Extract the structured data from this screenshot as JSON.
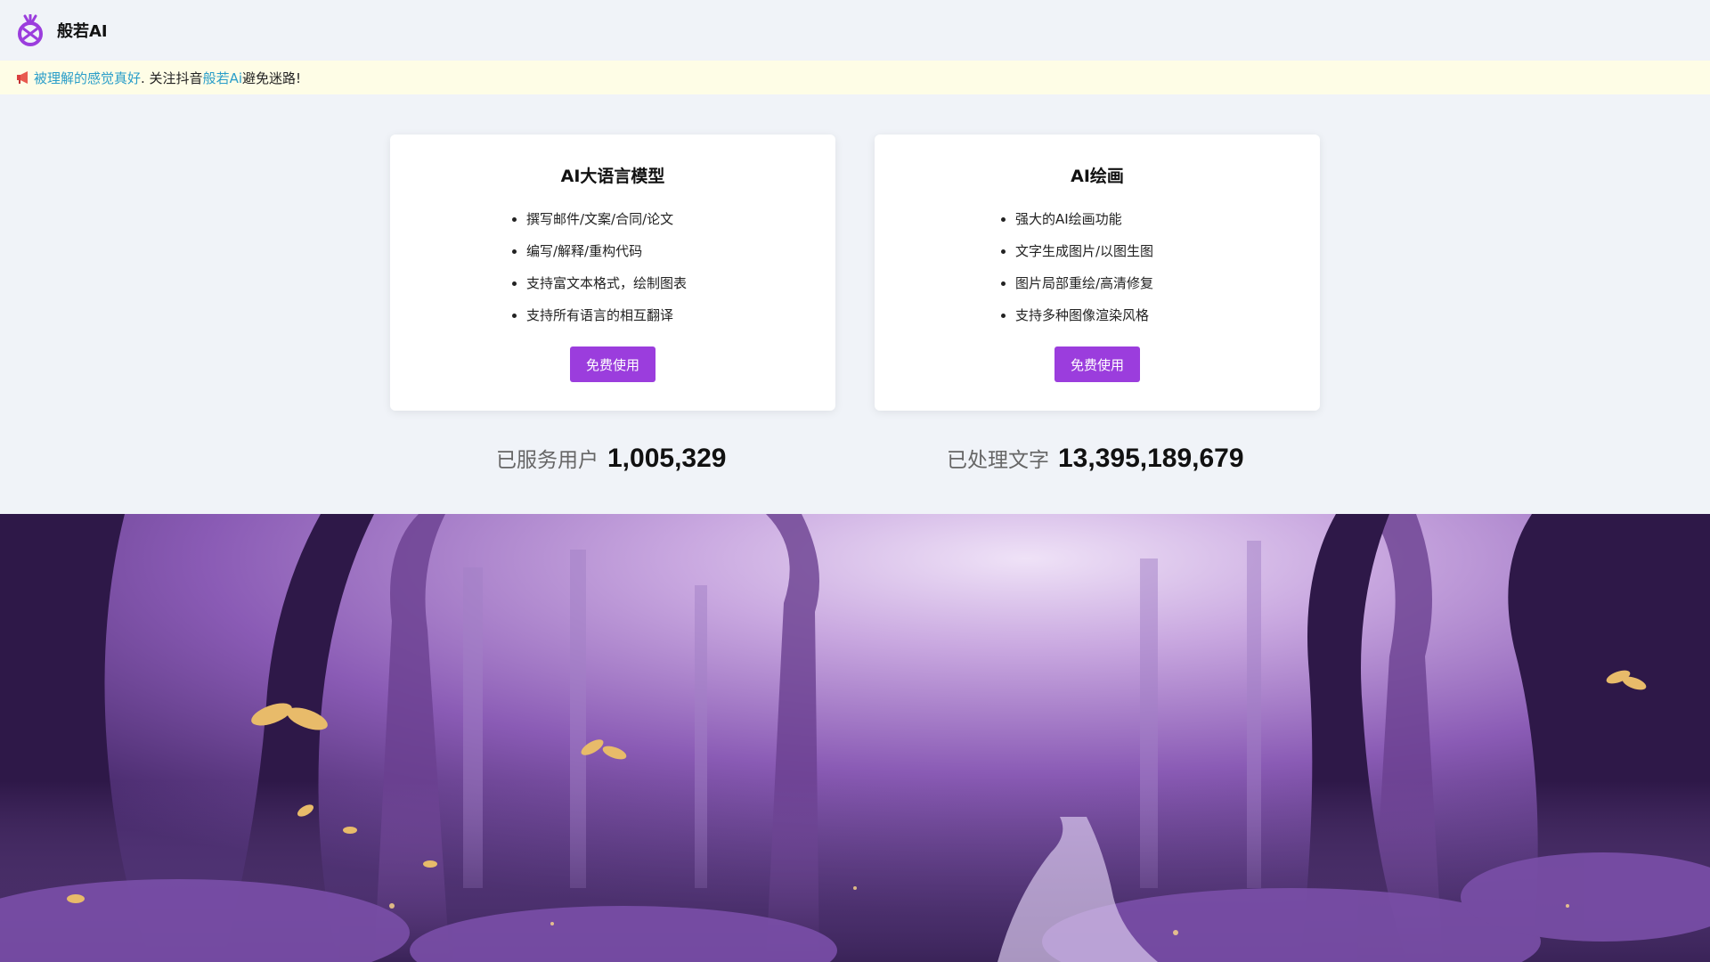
{
  "header": {
    "brand": "般若AI",
    "logo_icon": "pineapple-logo-icon"
  },
  "notice": {
    "icon": "megaphone-icon",
    "link1": "被理解的感觉真好",
    "sep": ". 关注抖音",
    "link2": "般若Ai",
    "tail": "避免迷路!"
  },
  "cards": [
    {
      "title": "AI大语言模型",
      "items": [
        "撰写邮件/文案/合同/论文",
        "编写/解释/重构代码",
        "支持富文本格式，绘制图表",
        "支持所有语言的相互翻译"
      ],
      "button": "免费使用"
    },
    {
      "title": "AI绘画",
      "items": [
        "强大的AI绘画功能",
        "文字生成图片/以图生图",
        "图片局部重绘/高清修复",
        "支持多种图像渲染风格"
      ],
      "button": "免费使用"
    }
  ],
  "stats": [
    {
      "label": "已服务用户",
      "value": "1,005,329"
    },
    {
      "label": "已处理文字",
      "value": "13,395,189,679"
    }
  ],
  "colors": {
    "accent": "#9b3ddd",
    "link": "#2a9ec9",
    "notice_bg": "#fefde6",
    "page_bg": "#f0f3f8"
  },
  "hero": {
    "image": "purple-forest-with-butterflies"
  }
}
